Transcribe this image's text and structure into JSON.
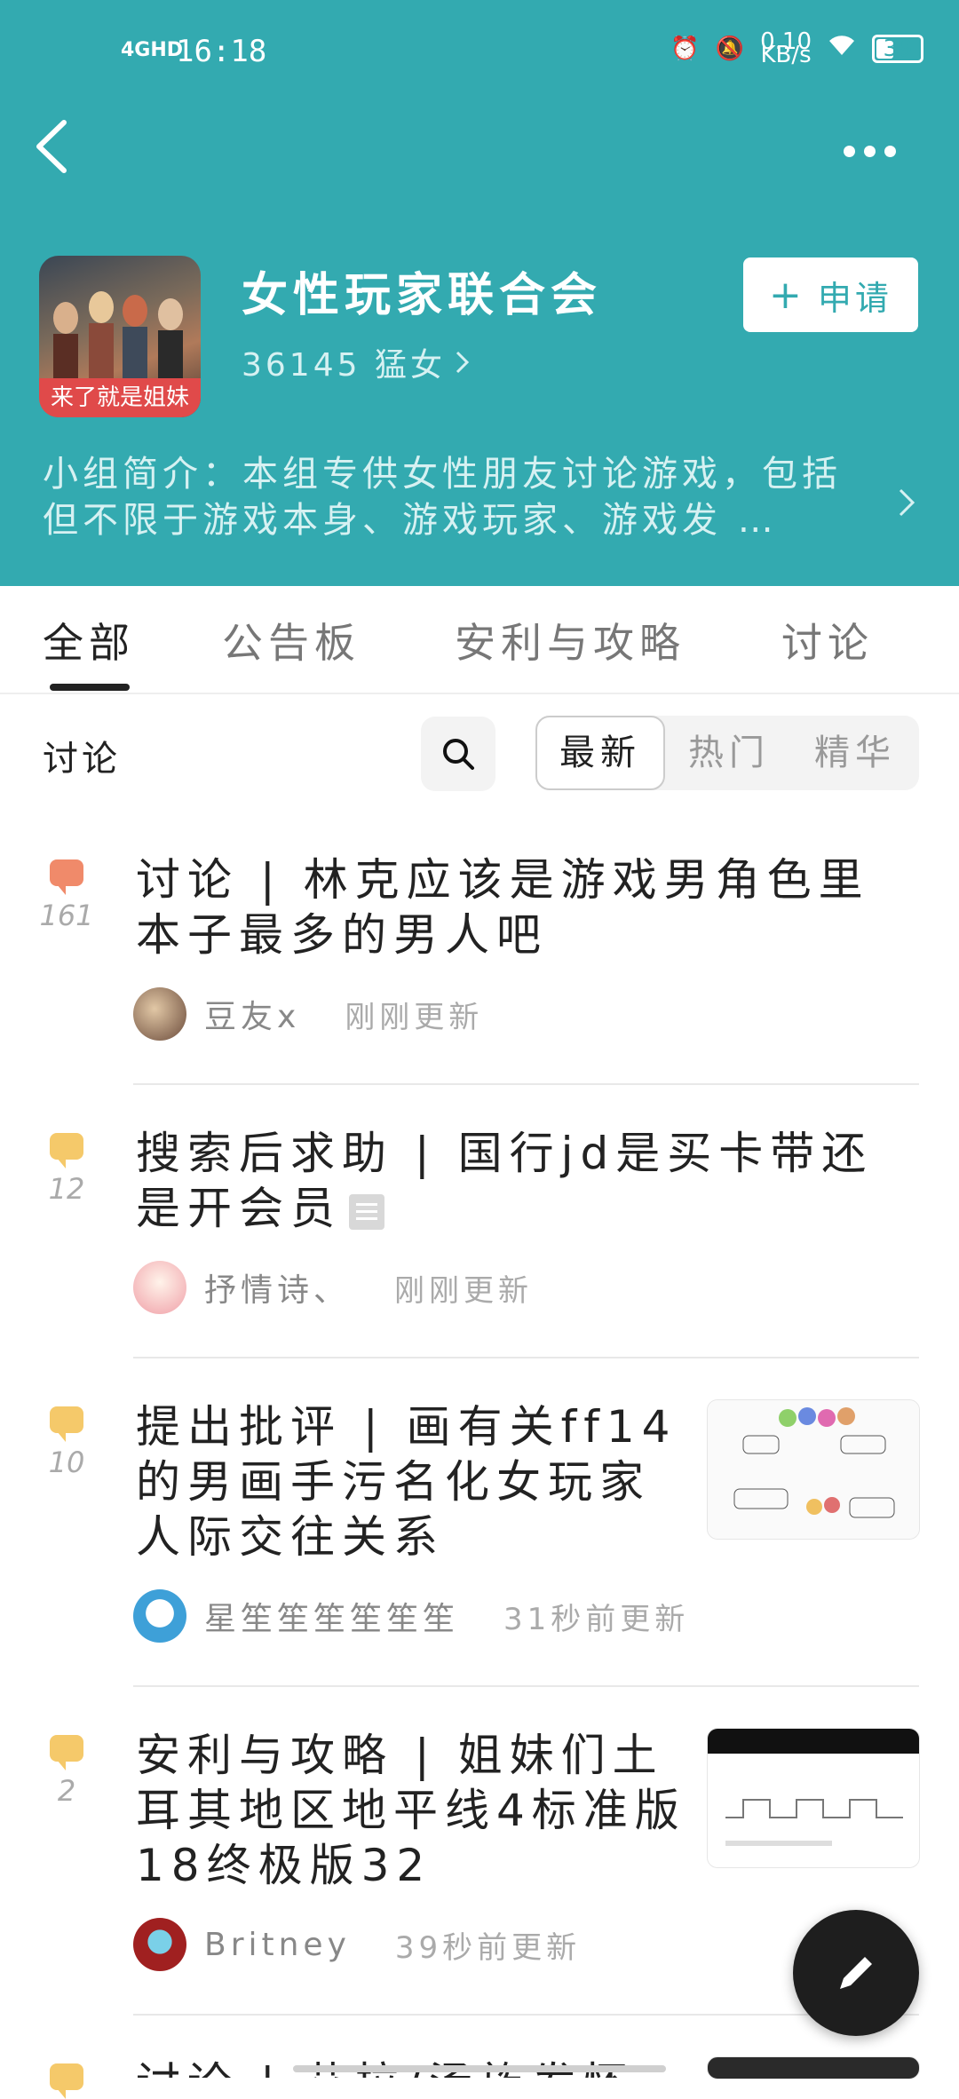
{
  "status_bar": {
    "network": "4GHD",
    "time": "16:18",
    "net_speed": "0.10\nKB/s",
    "battery": "39"
  },
  "group": {
    "name": "女性玩家联合会",
    "avatar_tag": "来了就是姐妹",
    "members": "36145 猛女",
    "apply_label": "申请",
    "intro": "小组简介：本组专供女性朋友讨论游戏，包括但不限于游戏本身、游戏玩家、游戏发 …"
  },
  "tabs": [
    "全部",
    "公告板",
    "安利与攻略",
    "讨论"
  ],
  "filter": {
    "label": "讨论",
    "options": [
      "最新",
      "热门",
      "精华"
    ],
    "selected": "最新"
  },
  "colors": {
    "header": "#33aab0",
    "icon_orange": "#f08a6a",
    "icon_yellow": "#f5c96a"
  },
  "posts": [
    {
      "count": "161",
      "icon_color": "#f08a6a",
      "title": "讨论 | 林克应该是游戏男角色里本子最多的男人吧",
      "user": "豆友x",
      "time": "刚刚更新"
    },
    {
      "count": "12",
      "icon_color": "#f5c96a",
      "title": "搜索后求助 | 国行jd是买卡带还是开会员",
      "user": "抒情诗、",
      "time": "刚刚更新"
    },
    {
      "count": "10",
      "icon_color": "#f5c96a",
      "title": "提出批评 | 画有关ff14的男画手污名化女玩家人际交往关系",
      "user": "星笙笙笙笙笙笙",
      "time": "31秒前更新"
    },
    {
      "count": "2",
      "icon_color": "#f5c96a",
      "title": "安利与攻略 | 姐妹们土耳其地区地平线4标准版18终极版32",
      "user": "Britney",
      "time": "39秒前更新"
    },
    {
      "count": "",
      "icon_color": "#f5c96a",
      "title": "讨论 | 艾拉/汤族发怀",
      "user": "",
      "time": ""
    }
  ]
}
